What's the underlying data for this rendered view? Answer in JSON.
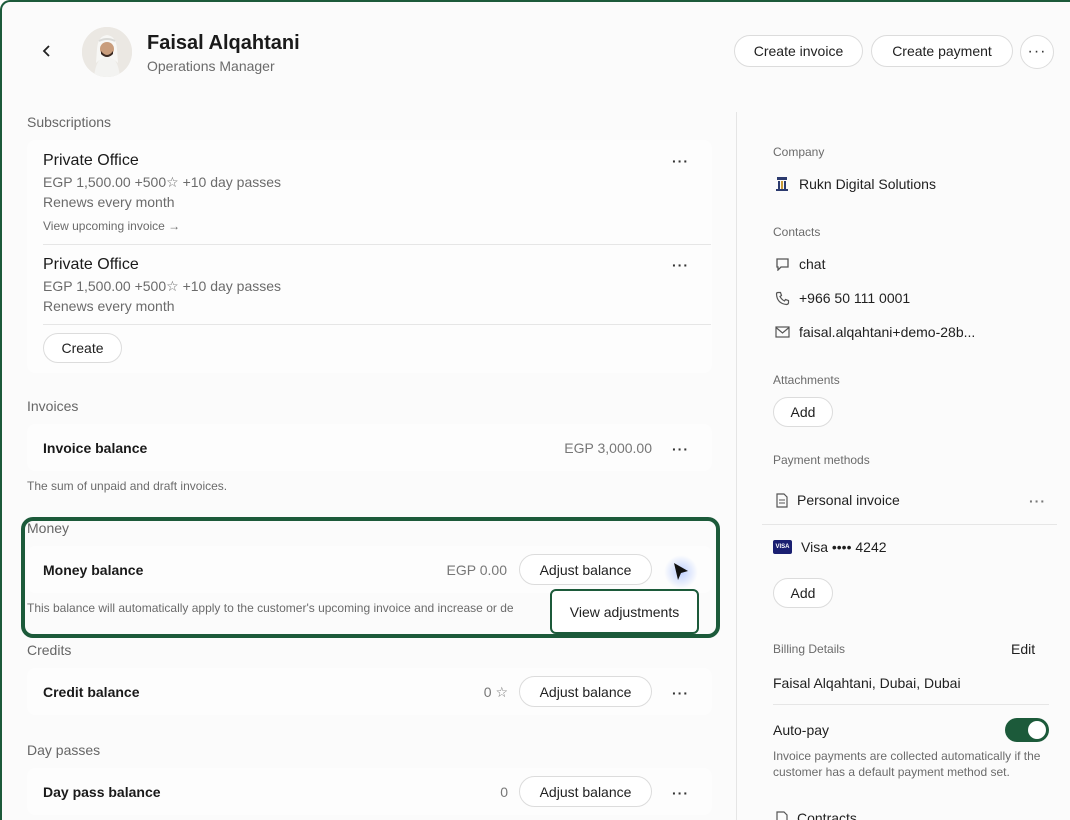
{
  "header": {
    "name": "Faisal Alqahtani",
    "role": "Operations Manager",
    "create_invoice": "Create invoice",
    "create_payment": "Create payment",
    "more": "···"
  },
  "subscriptions": {
    "title": "Subscriptions",
    "items": [
      {
        "name": "Private Office",
        "price": "EGP 1,500.00 +500☆ +10 day passes",
        "renew": "Renews every month",
        "link": "View upcoming invoice →"
      },
      {
        "name": "Private Office",
        "price": "EGP 1,500.00 +500☆ +10 day passes",
        "renew": "Renews every month"
      }
    ],
    "create_label": "Create"
  },
  "invoices": {
    "title": "Invoices",
    "label": "Invoice balance",
    "value": "EGP 3,000.00",
    "note": "The sum of unpaid and draft invoices."
  },
  "money": {
    "title": "Money",
    "label": "Money balance",
    "value": "EGP 0.00",
    "adjust": "Adjust balance",
    "note": "This balance will automatically apply to the customer's upcoming invoice and increase or de",
    "view_adjustments": "View adjustments"
  },
  "credits": {
    "title": "Credits",
    "label": "Credit balance",
    "value": "0 ☆",
    "adjust": "Adjust balance"
  },
  "day_passes": {
    "title": "Day passes",
    "label": "Day pass balance",
    "value": "0",
    "adjust": "Adjust balance"
  },
  "sidebar": {
    "company_label": "Company",
    "company": "Rukn Digital Solutions",
    "contacts_label": "Contacts",
    "chat": "chat",
    "phone": "+966 50 111 0001",
    "email": "faisal.alqahtani+demo-28b...",
    "attachments_label": "Attachments",
    "attachments_add": "Add",
    "payment_methods_label": "Payment methods",
    "personal_invoice": "Personal invoice",
    "visa_badge": "VISA",
    "visa": "Visa •••• 4242",
    "payment_add": "Add",
    "billing_label": "Billing Details",
    "billing_edit": "Edit",
    "billing_value": "Faisal Alqahtani, Dubai, Dubai",
    "autopay_label": "Auto-pay",
    "autopay_on": true,
    "autopay_note": "Invoice payments are collected automatically if the customer has a default payment method set.",
    "contracts": "Contracts"
  },
  "colors": {
    "accent": "#1c5a3a"
  }
}
